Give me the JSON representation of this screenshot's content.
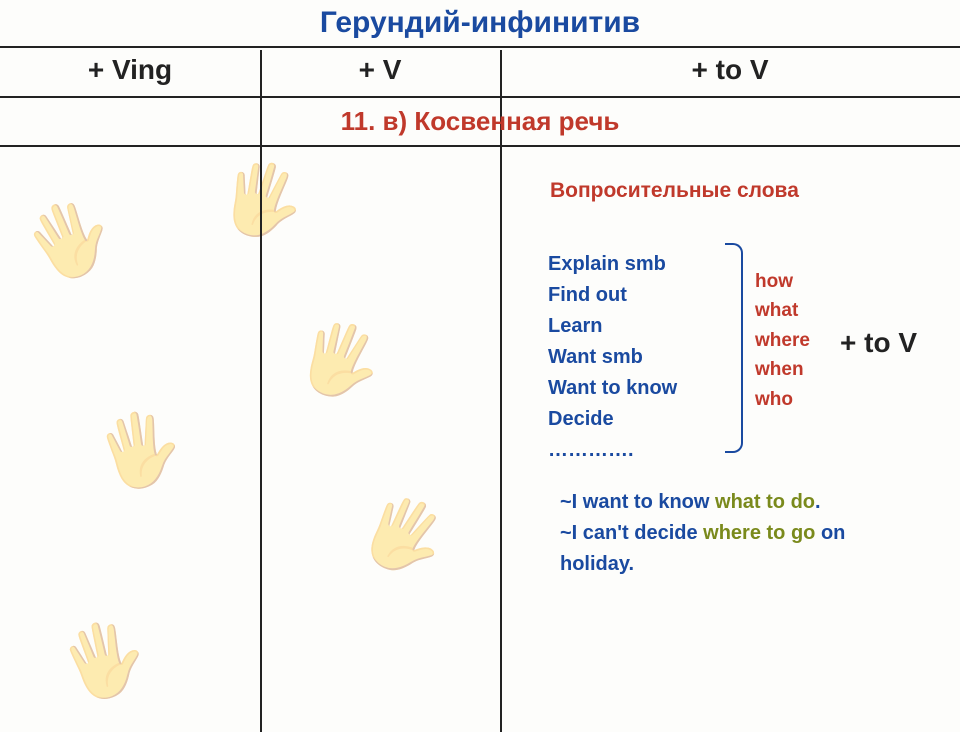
{
  "title": "Герундий-инфинитив",
  "columns": {
    "c1": "+  Ving",
    "c2": "+  V",
    "c3": "+  to V"
  },
  "section": "11. в)   Косвенная речь",
  "subhead": "Вопросительные слова",
  "verbs": {
    "v1": "Explain smb",
    "v2": "Find out",
    "v3": "Learn",
    "v4": "Want smb",
    "v5": "Want to know",
    "v6": "Decide",
    "v7": "…………."
  },
  "qwords": {
    "q1": "how",
    "q2": "what",
    "q3": "where",
    "q4": "when",
    "q5": "who"
  },
  "formula": "+ to V",
  "ex1": {
    "a": "~I want to know ",
    "b": "what to do",
    "c": "."
  },
  "ex2": {
    "a": "~I can't decide ",
    "b": "where to go",
    "c": " on holiday."
  },
  "hands": {
    "h1": "🖐",
    "h2": "🖐",
    "h3": "🖐",
    "h4": "🖐",
    "h5": "🖐",
    "h6": "🖐"
  }
}
